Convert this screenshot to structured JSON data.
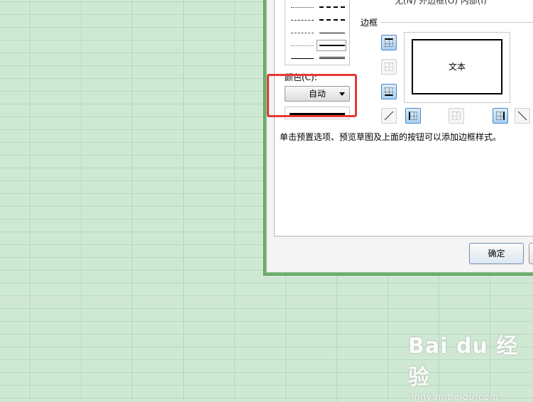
{
  "dialog": {
    "preset_labels": "无(N)   外边框(O)  内部(I)",
    "color": {
      "label": "颜色(C):",
      "selected": "自动",
      "swatch_color": "#000000"
    },
    "border": {
      "section_title": "边框",
      "preview_text": "文本"
    },
    "hint": "单击预置选项、预览草图及上面的按钮可以添加边框样式。",
    "ok_label": "确定"
  },
  "highlight_color": "#e53935",
  "watermark": {
    "logo": "Bai du 经验",
    "url": "jingyan.baidu.com"
  }
}
